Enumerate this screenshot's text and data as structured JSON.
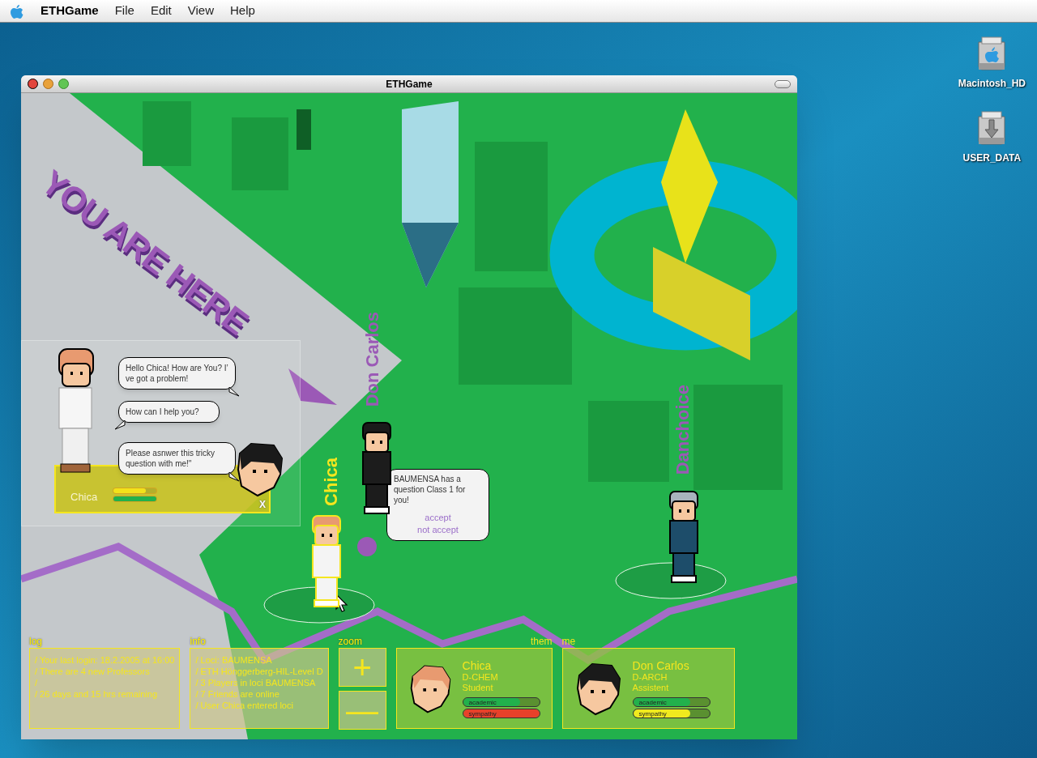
{
  "menu_bar": {
    "app": "ETHGame",
    "items": [
      "File",
      "Edit",
      "View",
      "Help"
    ]
  },
  "desktop_icons": [
    {
      "label": "Macintosh_HD"
    },
    {
      "label": "USER_DATA"
    }
  ],
  "window": {
    "title": "ETHGame"
  },
  "map": {
    "banner": "YOU ARE HERE",
    "players": [
      {
        "name": "Don Carlos",
        "selected": false
      },
      {
        "name": "Chica",
        "selected": true
      },
      {
        "name": "Danchoice",
        "selected": false
      }
    ]
  },
  "chat": {
    "name": "Chica",
    "close": "X",
    "bars": [
      {
        "level": 0.75,
        "color": "#f2e21a"
      },
      {
        "level": 1,
        "color": "#22b14c"
      }
    ],
    "messages": [
      {
        "text": "Hello Chica! How are You? I’ ve got a problem!",
        "kind": "outgoing"
      },
      {
        "text": "How can I help you?",
        "kind": "incoming"
      },
      {
        "text": "Please asnwer this tricky question with me!\"",
        "kind": "outgoing"
      }
    ]
  },
  "invitation": {
    "text": "BAUMENSA has a question Class 1 for you!",
    "actions": [
      "accept",
      "not accept"
    ]
  },
  "log": {
    "title": "log",
    "lines": [
      "/ Your last login: 18.2.2005 at 16:00",
      "/ There are 4 new Professors",
      "/",
      "/ 26 days and 15 hrs remaining"
    ]
  },
  "info": {
    "title": "info",
    "lines": [
      "/ Loci: BAUMENSA",
      "/ ETH Hönggerberg-HIL-Level D",
      "/ 3 Players in loci BAUMENSA",
      "/ 7 Friends are online",
      "/ User Chica entered loci"
    ]
  },
  "zoom": {
    "title": "zoom",
    "buttons": [
      "+",
      "—"
    ]
  },
  "them": {
    "label": "them",
    "name": "Chica",
    "department": "D-CHEM",
    "role": "Student",
    "meters": [
      {
        "label": "academic",
        "level": 0.75,
        "color": "#22b14c"
      },
      {
        "label": "sympathy",
        "level": 1,
        "color": "#e8412a"
      }
    ]
  },
  "me": {
    "label": "me",
    "name": "Don Carlos",
    "department": "D-ARCH",
    "role": "Assistent",
    "meters": [
      {
        "label": "academic",
        "level": 0.75,
        "color": "#22b14c"
      },
      {
        "label": "sympathy",
        "level": 0.75,
        "color": "#f0ea1e"
      }
    ]
  }
}
